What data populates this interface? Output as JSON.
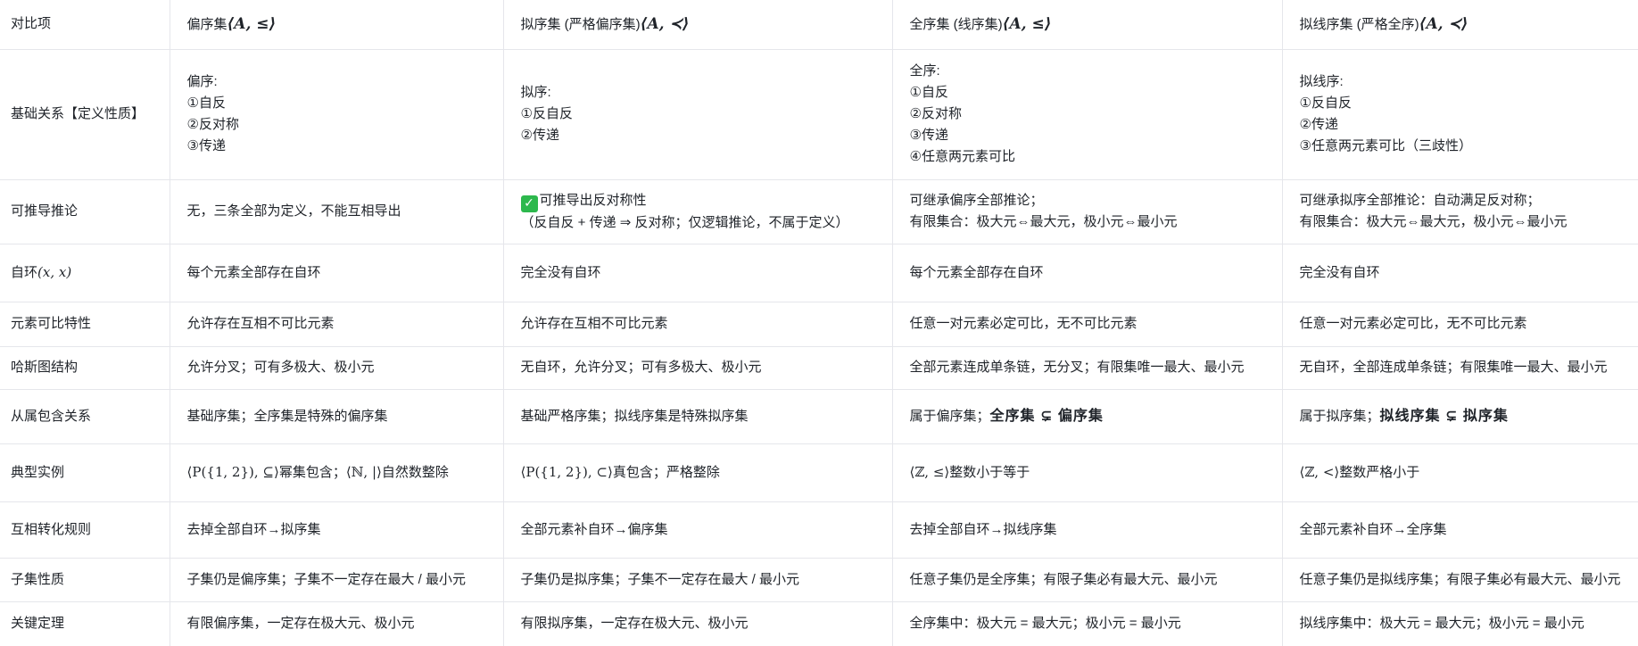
{
  "header": {
    "label": "对比项",
    "col1_text": "偏序集",
    "col1_math": "⟨A, ≤⟩",
    "col2_text": "拟序集 (严格偏序集)",
    "col2_math": "⟨A, ≺⟩",
    "col3_text": "全序集 (线序集)",
    "col3_math": "⟨A, ≤⟩",
    "col4_text": "拟线序集 (严格全序)",
    "col4_math": "⟨A, ≺⟩"
  },
  "rows": {
    "basic": {
      "label": "基础关系【定义性质】",
      "c1": [
        "偏序:",
        "①自反",
        "②反对称",
        "③传递"
      ],
      "c2": [
        "拟序:",
        "①反自反",
        "②传递"
      ],
      "c3": [
        "全序:",
        "①自反",
        "②反对称",
        "③传递",
        "④任意两元素可比"
      ],
      "c4": [
        "拟线序:",
        "①反自反",
        "②传递",
        "③任意两元素可比（三歧性）"
      ]
    },
    "derive": {
      "label": "可推导推论",
      "c1": "无，三条全部为定义，不能互相导出",
      "c2_check": "✓",
      "c2_line1": "可推导出反对称性",
      "c2_line2": "（反自反 + 传递 ⇒ 反对称；仅逻辑推论，不属于定义）",
      "c3_line1": "可继承偏序全部推论；",
      "c3_line2": "有限集合：极大元⇔最大元，极小元⇔最小元",
      "c4_line1": "可继承拟序全部推论：自动满足反对称；",
      "c4_line2": "有限集合：极大元⇔最大元，极小元⇔最小元"
    },
    "loop": {
      "label_text": "自环",
      "label_math": "(x, x)",
      "c1": "每个元素全部存在自环",
      "c2": "完全没有自环",
      "c3": "每个元素全部存在自环",
      "c4": "完全没有自环"
    },
    "comparable": {
      "label": "元素可比特性",
      "c1": "允许存在互相不可比元素",
      "c2": "允许存在互相不可比元素",
      "c3": "任意一对元素必定可比，无不可比元素",
      "c4": "任意一对元素必定可比，无不可比元素"
    },
    "hasse": {
      "label": "哈斯图结构",
      "c1": "允许分叉；可有多极大、极小元",
      "c2": "无自环，允许分叉；可有多极大、极小元",
      "c3": "全部元素连成单条链，无分叉；有限集唯一最大、最小元",
      "c4": "无自环，全部连成单条链；有限集唯一最大、最小元"
    },
    "inclusion": {
      "label": "从属包含关系",
      "c1": "基础序集；全序集是特殊的偏序集",
      "c2": "基础严格序集；拟线序集是特殊拟序集",
      "c3_text": "属于偏序集；",
      "c3_bold": "全序集 ⊊ 偏序集",
      "c4_text": "属于拟序集；",
      "c4_bold": "拟线序集 ⊊ 拟序集"
    },
    "example": {
      "label": "典型实例",
      "c1_math1": "⟨P({1, 2}), ⊆⟩",
      "c1_text1": "幂集包含；",
      "c1_math2": "⟨ℕ, |⟩",
      "c1_text2": "自然数整除",
      "c2_math": "⟨P({1, 2}), ⊂⟩",
      "c2_text": "真包含；严格整除",
      "c3_math": "⟨ℤ, ≤⟩",
      "c3_text": "整数小于等于",
      "c4_math": "⟨ℤ, <⟩",
      "c4_text": "整数严格小于"
    },
    "convert": {
      "label": "互相转化规则",
      "c1": "去掉全部自环→拟序集",
      "c2": "全部元素补自环→偏序集",
      "c3": "去掉全部自环→拟线序集",
      "c4": "全部元素补自环→全序集"
    },
    "subset": {
      "label": "子集性质",
      "c1": "子集仍是偏序集；子集不一定存在最大 / 最小元",
      "c2": "子集仍是拟序集；子集不一定存在最大 / 最小元",
      "c3": "任意子集仍是全序集；有限子集必有最大元、最小元",
      "c4": "任意子集仍是拟线序集；有限子集必有最大元、最小元"
    },
    "theorem": {
      "label": "关键定理",
      "c1": "有限偏序集，一定存在极大元、极小元",
      "c2": "有限拟序集，一定存在极大元、极小元",
      "c3": "全序集中：极大元 = 最大元；极小元 = 最小元",
      "c4": "拟线序集中：极大元 = 最大元；极小元 = 最小元"
    }
  }
}
